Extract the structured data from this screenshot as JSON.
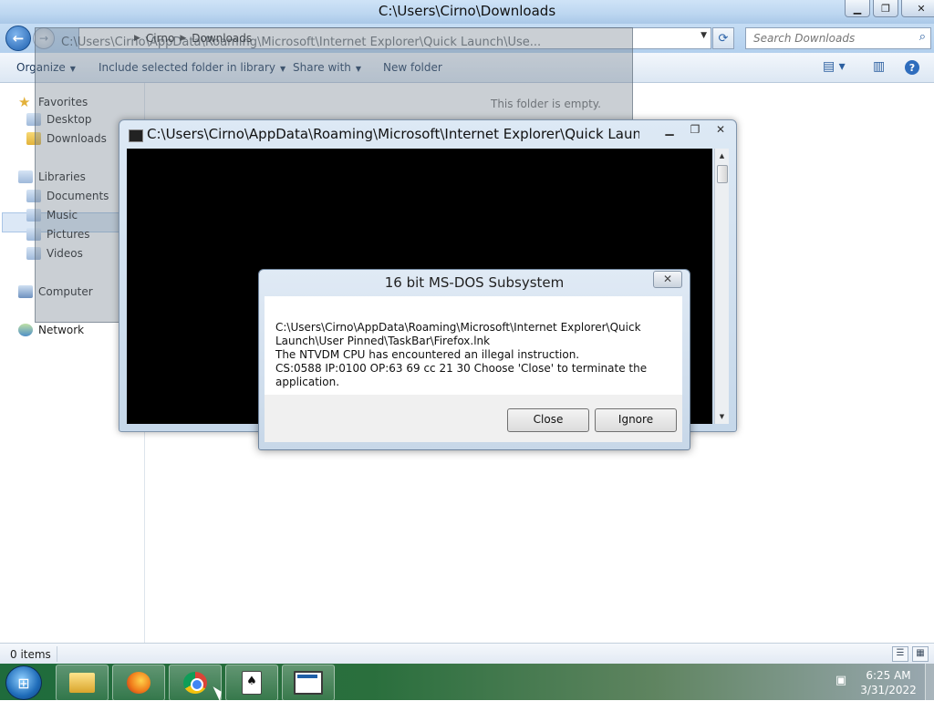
{
  "explorer": {
    "title": "C:\\Users\\Cirno\\Downloads",
    "controls": {
      "minimize": "▁",
      "maximize": "❐",
      "close": "✕"
    },
    "breadcrumb": [
      "Cirno",
      "Downloads"
    ],
    "search_placeholder": "Search Downloads",
    "toolbar": {
      "organize": "Organize",
      "include": "Include selected folder in library",
      "share": "Share with",
      "new_folder": "New folder"
    },
    "empty_message": "This folder is empty.",
    "nav": {
      "favorites": "Favorites",
      "desktop": "Desktop",
      "downloads": "Downloads",
      "libraries": "Libraries",
      "documents": "Documents",
      "music": "Music",
      "pictures": "Pictures",
      "videos": "Videos",
      "computer": "Computer",
      "network": "Network"
    },
    "status": "0 items"
  },
  "ghost_window": {
    "title": "C:\\Users\\Cirno\\AppData\\Roaming\\Microsoft\\Internet Explorer\\Quick Launch\\Use..."
  },
  "console": {
    "title": "C:\\Users\\Cirno\\AppData\\Roaming\\Microsoft\\Internet Explorer\\Quick Launch\\Use..."
  },
  "dialog": {
    "title": "16 bit MS-DOS Subsystem",
    "lines": [
      "C:\\Users\\Cirno\\AppData\\Roaming\\Microsoft\\Internet Explorer\\Quick",
      "Launch\\User Pinned\\TaskBar\\Firefox.lnk",
      "The NTVDM CPU has encountered an illegal instruction.",
      "CS:0588 IP:0100 OP:63 69 cc 21 30 Choose 'Close' to terminate the application."
    ],
    "close_button": "Close",
    "ignore_button": "Ignore"
  },
  "taskbar": {
    "apps": [
      "windows-explorer-icon",
      "firefox-icon",
      "chrome-icon",
      "solitaire-icon",
      "console-window-icon"
    ],
    "time": "6:25 AM",
    "date": "3/31/2022"
  },
  "colors": {
    "taskbar_green": "#2a6f3d",
    "dialog_frame": "#c7d7e8",
    "console_bg": "#000000"
  }
}
